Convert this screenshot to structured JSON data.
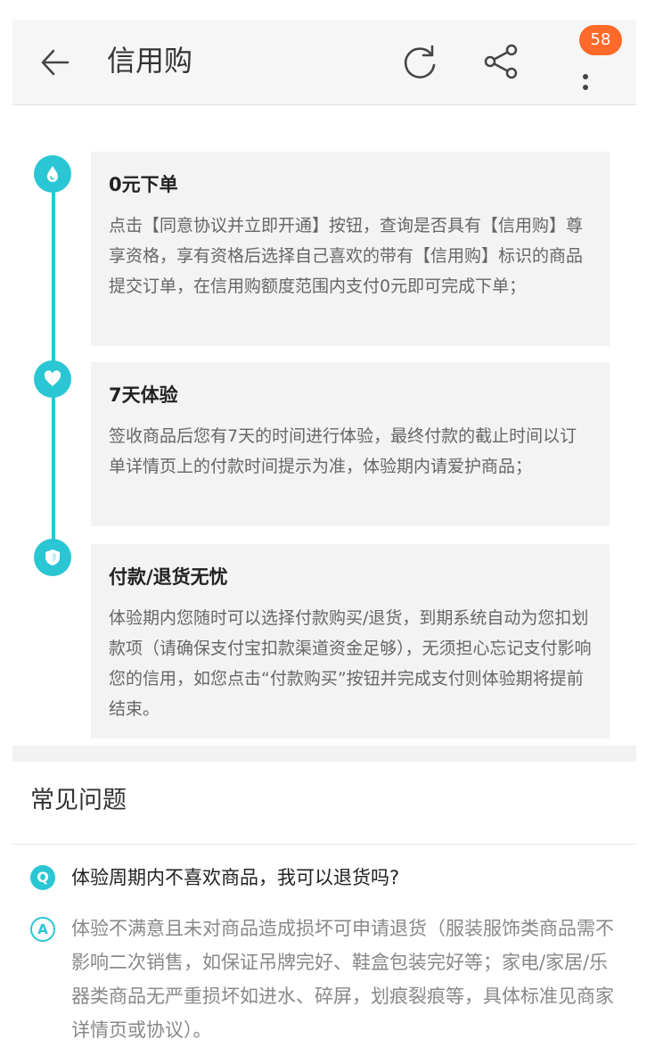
{
  "header": {
    "title": "信用购",
    "badge_count": "58",
    "back_icon": "arrow-left-icon",
    "refresh_icon": "refresh-icon",
    "share_icon": "share-icon",
    "more_icon": "more-vertical-icon"
  },
  "steps": [
    {
      "icon": "drop-icon",
      "title": "0元下单",
      "desc": "点击【同意协议并立即开通】按钮，查询是否具有【信用购】尊享资格，享有资格后选择自己喜欢的带有【信用购】标识的商品提交订单，在信用购额度范围内支付0元即可完成下单；"
    },
    {
      "icon": "heart-icon",
      "title": "7天体验",
      "desc": "签收商品后您有7天的时间进行体验，最终付款的截止时间以订单详情页上的付款时间提示为准，体验期内请爱护商品；"
    },
    {
      "icon": "shield-icon",
      "title": "付款/退货无忧",
      "desc": "体验期内您随时可以选择付款购买/退货，到期系统自动为您扣划款项（请确保支付宝扣款渠道资金足够），无须担心忘记支付影响您的信用，如您点击“付款购买”按钮并完成支付则体验期将提前结束。"
    }
  ],
  "faq": {
    "heading": "常见问题",
    "q_label": "Q",
    "a_label": "A",
    "question": "体验周期内不喜欢商品，我可以退货吗?",
    "answer": "体验不满意且未对商品造成损坏可申请退货（服装服饰类商品需不影响二次销售，如保证吊牌完好、鞋盒包装完好等；家电/家居/乐器类商品无严重损坏如进水、碎屏，划痕裂痕等，具体标准见商家详情页或协议）。"
  },
  "colors": {
    "accent": "#2bc6d3",
    "badge": "#ff6a2a"
  }
}
